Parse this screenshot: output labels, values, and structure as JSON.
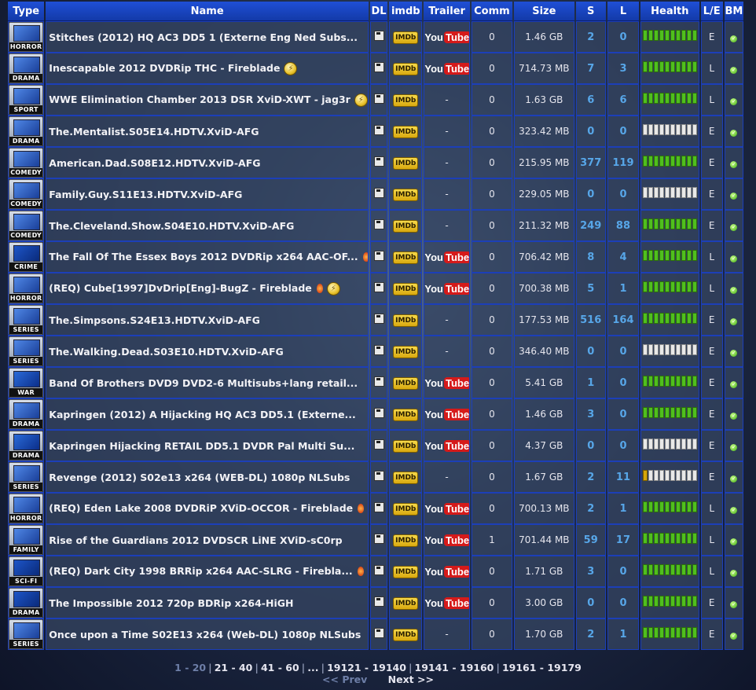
{
  "headers": [
    "Type",
    "Name",
    "DL",
    "imdb",
    "Trailer",
    "Comm",
    "Size",
    "S",
    "L",
    "Health",
    "L/E",
    "BM"
  ],
  "rows": [
    {
      "cat": "HORROR",
      "icon": "tv",
      "name": "Stitches (2012) HQ AC3 DD5 1 (Externe Eng Ned Subs...",
      "req": false,
      "free": false,
      "trailer": "youtube",
      "comm": "0",
      "size": "1.46 GB",
      "s": "2",
      "l": "0",
      "health": "full",
      "le": "E"
    },
    {
      "cat": "DRAMA",
      "icon": "tv",
      "name": "Inescapable 2012 DVDRip THC - Fireblade",
      "req": false,
      "free": true,
      "trailer": "youtube",
      "comm": "0",
      "size": "714.73 MB",
      "s": "7",
      "l": "3",
      "health": "full",
      "le": "L"
    },
    {
      "cat": "SPORT",
      "icon": "tv",
      "name": "WWE Elimination Chamber 2013 DSR XviD-XWT - jag3r",
      "req": false,
      "free": true,
      "trailer": "-",
      "comm": "0",
      "size": "1.63 GB",
      "s": "6",
      "l": "6",
      "health": "full",
      "le": "L"
    },
    {
      "cat": "DRAMA",
      "icon": "tv",
      "name": "The.Mentalist.S05E14.HDTV.XviD-AFG",
      "req": false,
      "free": false,
      "trailer": "-",
      "comm": "0",
      "size": "323.42 MB",
      "s": "0",
      "l": "0",
      "health": "dead",
      "le": "E"
    },
    {
      "cat": "COMEDY",
      "icon": "tv",
      "name": "American.Dad.S08E12.HDTV.XviD-AFG",
      "req": false,
      "free": false,
      "trailer": "-",
      "comm": "0",
      "size": "215.95 MB",
      "s": "377",
      "l": "119",
      "health": "full",
      "le": "E"
    },
    {
      "cat": "COMEDY",
      "icon": "tv",
      "name": "Family.Guy.S11E13.HDTV.XviD-AFG",
      "req": false,
      "free": false,
      "trailer": "-",
      "comm": "0",
      "size": "229.05 MB",
      "s": "0",
      "l": "0",
      "health": "dead",
      "le": "E"
    },
    {
      "cat": "COMEDY",
      "icon": "tv",
      "name": "The.Cleveland.Show.S04E10.HDTV.XviD-AFG",
      "req": false,
      "free": false,
      "trailer": "-",
      "comm": "0",
      "size": "211.32 MB",
      "s": "249",
      "l": "88",
      "health": "full",
      "le": "E"
    },
    {
      "cat": "CRIME",
      "icon": "bluray",
      "name": "The Fall Of The Essex Boys 2012 DVDRip x264 AAC-OF...",
      "req": true,
      "free": true,
      "trailer": "youtube",
      "comm": "0",
      "size": "706.42 MB",
      "s": "8",
      "l": "4",
      "health": "full",
      "le": "L"
    },
    {
      "cat": "HORROR",
      "icon": "tv",
      "name": "(REQ) Cube[1997]DvDrip[Eng]-BugZ - Fireblade",
      "req": true,
      "free": true,
      "trailer": "youtube",
      "comm": "0",
      "size": "700.38 MB",
      "s": "5",
      "l": "1",
      "health": "full",
      "le": "L"
    },
    {
      "cat": "SERIES",
      "icon": "tv",
      "name": "The.Simpsons.S24E13.HDTV.XviD-AFG",
      "req": false,
      "free": false,
      "trailer": "-",
      "comm": "0",
      "size": "177.53 MB",
      "s": "516",
      "l": "164",
      "health": "full",
      "le": "E"
    },
    {
      "cat": "SERIES",
      "icon": "tv",
      "name": "The.Walking.Dead.S03E10.HDTV.XviD-AFG",
      "req": false,
      "free": false,
      "trailer": "-",
      "comm": "0",
      "size": "346.40 MB",
      "s": "0",
      "l": "0",
      "health": "dead",
      "le": "E"
    },
    {
      "cat": "WAR",
      "icon": "dvd",
      "name": "Band Of Brothers DVD9 DVD2-6 Multisubs+lang retail...",
      "req": false,
      "free": false,
      "trailer": "youtube",
      "comm": "0",
      "size": "5.41 GB",
      "s": "1",
      "l": "0",
      "health": "full",
      "le": "E"
    },
    {
      "cat": "DRAMA",
      "icon": "tv",
      "name": "Kapringen (2012) A Hijacking HQ AC3 DD5.1 (Externe...",
      "req": false,
      "free": false,
      "trailer": "youtube",
      "comm": "0",
      "size": "1.46 GB",
      "s": "3",
      "l": "0",
      "health": "full",
      "le": "E"
    },
    {
      "cat": "DRAMA",
      "icon": "dvd",
      "name": "Kapringen Hijacking RETAIL DD5.1 DVDR Pal Multi Su...",
      "req": false,
      "free": false,
      "trailer": "youtube",
      "comm": "0",
      "size": "4.37 GB",
      "s": "0",
      "l": "0",
      "health": "dead",
      "le": "E"
    },
    {
      "cat": "SERIES",
      "icon": "tv",
      "name": "Revenge (2012) S02e13 x264 (WEB-DL) 1080p NLSubs",
      "req": false,
      "free": false,
      "trailer": "-",
      "comm": "0",
      "size": "1.67 GB",
      "s": "2",
      "l": "11",
      "health": "low",
      "le": "E"
    },
    {
      "cat": "HORROR",
      "icon": "tv",
      "name": "(REQ) Eden Lake 2008 DVDRiP XViD-OCCOR - Fireblade",
      "req": true,
      "free": true,
      "trailer": "youtube",
      "comm": "0",
      "size": "700.13 MB",
      "s": "2",
      "l": "1",
      "health": "full",
      "le": "L"
    },
    {
      "cat": "FAMILY",
      "icon": "tv",
      "name": "Rise of the Guardians 2012 DVDSCR LiNE XViD-sC0rp",
      "req": false,
      "free": false,
      "trailer": "youtube",
      "comm": "1",
      "size": "701.44 MB",
      "s": "59",
      "l": "17",
      "health": "full",
      "le": "L"
    },
    {
      "cat": "SCI-FI",
      "icon": "bluray",
      "name": "(REQ) Dark City 1998 BRRip x264 AAC-SLRG - Firebla...",
      "req": true,
      "free": true,
      "trailer": "youtube",
      "comm": "0",
      "size": "1.71 GB",
      "s": "3",
      "l": "0",
      "health": "full",
      "le": "L"
    },
    {
      "cat": "DRAMA",
      "icon": "bluray",
      "name": "The Impossible 2012 720p BDRip x264-HiGH",
      "req": false,
      "free": false,
      "trailer": "youtube",
      "comm": "0",
      "size": "3.00 GB",
      "s": "0",
      "l": "0",
      "health": "full",
      "le": "E"
    },
    {
      "cat": "SERIES",
      "icon": "tv",
      "name": "Once upon a Time S02E13 x264 (Web-DL) 1080p NLSubs",
      "req": false,
      "free": false,
      "trailer": "-",
      "comm": "0",
      "size": "1.70 GB",
      "s": "2",
      "l": "1",
      "health": "full",
      "le": "E"
    }
  ],
  "labels": {
    "imdb": "IMDb",
    "you": "You",
    "tube": "Tube"
  },
  "pager": {
    "pages": [
      "1 - 20",
      "21 - 40",
      "41 - 60",
      "...",
      "19121 - 19140",
      "19141 - 19160",
      "19161 - 19179"
    ],
    "prev": "<< Prev",
    "next": "Next >>"
  },
  "colors": {
    "header": "#1f4fd6",
    "border": "#1c3fb8",
    "seeds": "#57a6e8",
    "health_ok": "#4fbf1e"
  }
}
